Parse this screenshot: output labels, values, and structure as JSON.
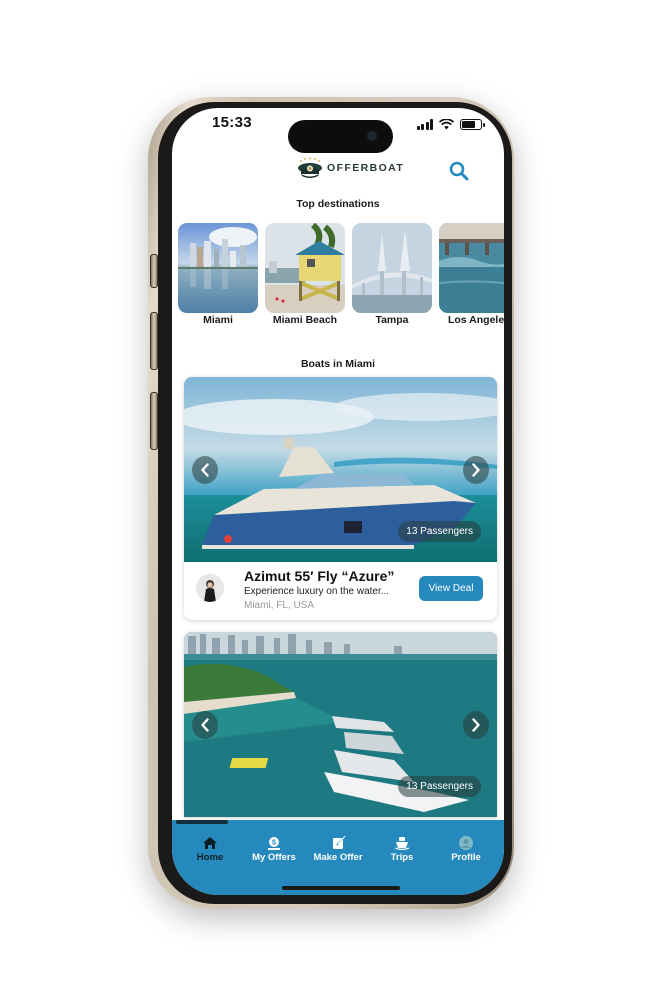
{
  "status_bar": {
    "time": "15:33",
    "battery_level": 0.7,
    "signal_bars": 4,
    "wifi": true
  },
  "header": {
    "logo_text": "OFFERBOAT",
    "search_icon": "search-icon"
  },
  "destinations": {
    "title": "Top destinations",
    "items": [
      {
        "label": "Miami"
      },
      {
        "label": "Miami Beach"
      },
      {
        "label": "Tampa"
      },
      {
        "label": "Los Angeles"
      }
    ]
  },
  "boats": {
    "title": "Boats in Miami",
    "items": [
      {
        "passengers": "13 Passengers",
        "name": "Azimut 55′ Fly “Azure”",
        "description": "Experience luxury on the water...",
        "location": "Miami, FL, USA",
        "cta": "View Deal"
      },
      {
        "passengers": "13 Passengers"
      }
    ]
  },
  "bottom_nav": {
    "items": [
      {
        "label": "Home",
        "icon": "home-icon",
        "active": true
      },
      {
        "label": "My Offers",
        "icon": "offers-icon",
        "active": false
      },
      {
        "label": "Make Offer",
        "icon": "edit-icon",
        "active": false
      },
      {
        "label": "Trips",
        "icon": "boat-icon",
        "active": false
      },
      {
        "label": "Profile",
        "icon": "profile-icon",
        "active": false
      }
    ]
  },
  "colors": {
    "accent": "#2589bd",
    "nav_active": "#0d1f26",
    "text": "#111111",
    "muted": "#9a9a9a"
  }
}
